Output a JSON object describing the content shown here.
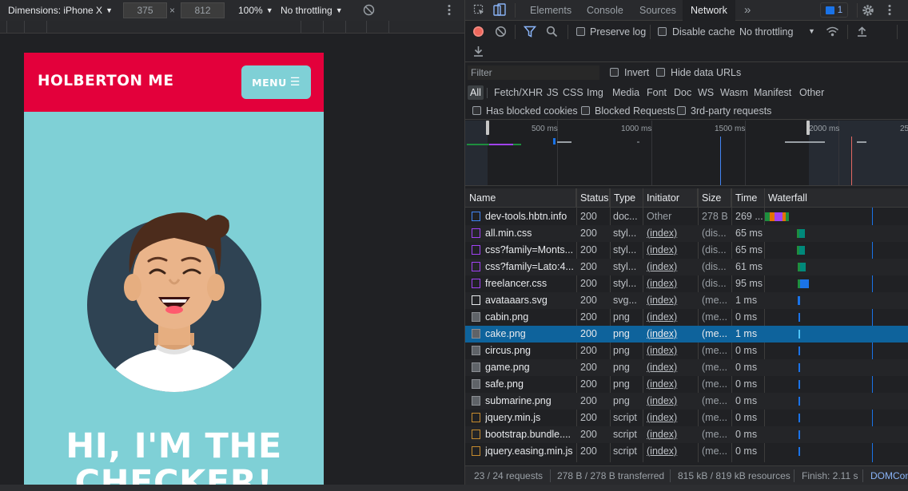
{
  "device_toolbar": {
    "device": "Dimensions: iPhone X",
    "width": "375",
    "times": "×",
    "height": "812",
    "zoom": "100%",
    "throttle": "No throttling"
  },
  "site": {
    "brand": "HOLBERTON ME",
    "menu_label": "MENU",
    "menu_icon": "hamburger-icon",
    "hero_title": "HI, I'M THE CHECKER!",
    "colors": {
      "nav": "#e3003b",
      "hero": "#7fd0d6"
    }
  },
  "devtools": {
    "tabs": [
      "Elements",
      "Console",
      "Sources",
      "Network"
    ],
    "active_tab": "Network",
    "more_tabs": "»",
    "issues_count": "1",
    "toolbar": {
      "preserve_log": "Preserve log",
      "disable_cache": "Disable cache",
      "throttling": "No throttling"
    },
    "filter": {
      "placeholder": "Filter",
      "invert": "Invert",
      "hide_data_urls": "Hide data URLs"
    },
    "type_filters": [
      "All",
      "Fetch/XHR",
      "JS",
      "CSS",
      "Img",
      "Media",
      "Font",
      "Doc",
      "WS",
      "Wasm",
      "Manifest",
      "Other"
    ],
    "blocked": {
      "has_blocked_cookies": "Has blocked cookies",
      "blocked_requests": "Blocked Requests",
      "third_party": "3rd-party requests"
    },
    "overview_labels": [
      "500 ms",
      "1000 ms",
      "1500 ms",
      "2000 ms",
      "25"
    ],
    "columns": [
      "Name",
      "Status",
      "Type",
      "Initiator",
      "Size",
      "Time",
      "Waterfall"
    ],
    "requests": [
      {
        "name": "dev-tools.hbtn.info",
        "status": "200",
        "type": "doc...",
        "initiator": "Other",
        "size": "278 B",
        "time": "269 ...",
        "icon": "document-icon"
      },
      {
        "name": "all.min.css",
        "status": "200",
        "type": "styl...",
        "initiator": "(index)",
        "size": "(dis...",
        "time": "65 ms",
        "icon": "stylesheet-icon"
      },
      {
        "name": "css?family=Monts...",
        "status": "200",
        "type": "styl...",
        "initiator": "(index)",
        "size": "(dis...",
        "time": "65 ms",
        "icon": "stylesheet-icon"
      },
      {
        "name": "css?family=Lato:4...",
        "status": "200",
        "type": "styl...",
        "initiator": "(index)",
        "size": "(dis...",
        "time": "61 ms",
        "icon": "stylesheet-icon"
      },
      {
        "name": "freelancer.css",
        "status": "200",
        "type": "styl...",
        "initiator": "(index)",
        "size": "(dis...",
        "time": "95 ms",
        "icon": "stylesheet-icon"
      },
      {
        "name": "avataaars.svg",
        "status": "200",
        "type": "svg...",
        "initiator": "(index)",
        "size": "(me...",
        "time": "1 ms",
        "icon": "svg-image-icon"
      },
      {
        "name": "cabin.png",
        "status": "200",
        "type": "png",
        "initiator": "(index)",
        "size": "(me...",
        "time": "0 ms",
        "icon": "image-icon"
      },
      {
        "name": "cake.png",
        "status": "200",
        "type": "png",
        "initiator": "(index)",
        "size": "(me...",
        "time": "1 ms",
        "icon": "image-icon",
        "selected": true
      },
      {
        "name": "circus.png",
        "status": "200",
        "type": "png",
        "initiator": "(index)",
        "size": "(me...",
        "time": "0 ms",
        "icon": "image-icon"
      },
      {
        "name": "game.png",
        "status": "200",
        "type": "png",
        "initiator": "(index)",
        "size": "(me...",
        "time": "0 ms",
        "icon": "image-icon"
      },
      {
        "name": "safe.png",
        "status": "200",
        "type": "png",
        "initiator": "(index)",
        "size": "(me...",
        "time": "0 ms",
        "icon": "image-icon"
      },
      {
        "name": "submarine.png",
        "status": "200",
        "type": "png",
        "initiator": "(index)",
        "size": "(me...",
        "time": "0 ms",
        "icon": "image-icon"
      },
      {
        "name": "jquery.min.js",
        "status": "200",
        "type": "script",
        "initiator": "(index)",
        "size": "(me...",
        "time": "0 ms",
        "icon": "script-icon"
      },
      {
        "name": "bootstrap.bundle....",
        "status": "200",
        "type": "script",
        "initiator": "(index)",
        "size": "(me...",
        "time": "0 ms",
        "icon": "script-icon"
      },
      {
        "name": "jquery.easing.min.js",
        "status": "200",
        "type": "script",
        "initiator": "(index)",
        "size": "(me...",
        "time": "0 ms",
        "icon": "script-icon"
      }
    ],
    "status_bar": {
      "requests": "23 / 24 requests",
      "transferred": "278 B / 278 B transferred",
      "resources": "815 kB / 819 kB resources",
      "finish": "Finish: 2.11 s",
      "domcontent": "DOMCon"
    }
  }
}
